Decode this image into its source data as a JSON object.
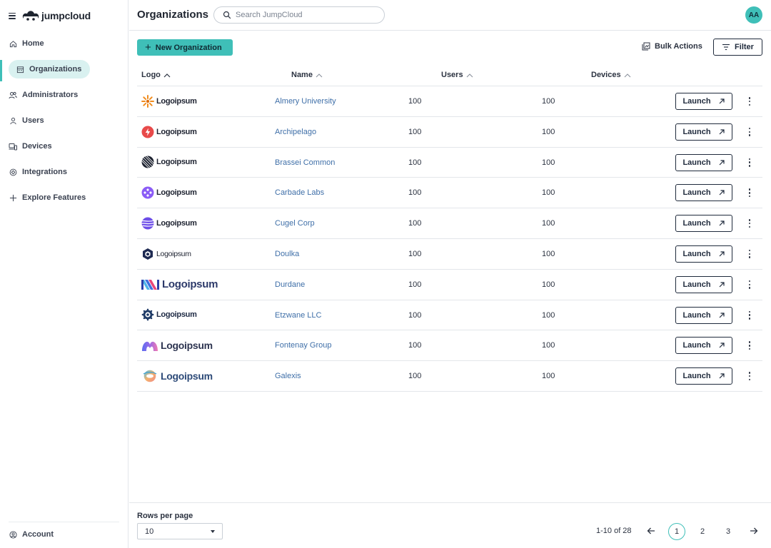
{
  "app": {
    "brand": "jumpcloud",
    "user_initials": "AA",
    "accent": "#3fbfb8",
    "link_color": "#3f6fa8"
  },
  "header": {
    "title": "Organizations",
    "search_placeholder": "Search JumpCloud"
  },
  "sidebar": {
    "items": [
      {
        "label": "Home",
        "icon": "home-icon"
      },
      {
        "label": "Organizations",
        "icon": "building-icon",
        "active": true
      },
      {
        "label": "Administrators",
        "icon": "admins-icon"
      },
      {
        "label": "Users",
        "icon": "user-icon"
      },
      {
        "label": "Devices",
        "icon": "devices-icon"
      },
      {
        "label": "Integrations",
        "icon": "integrations-icon"
      },
      {
        "label": "Explore Features",
        "icon": "plus-icon"
      }
    ],
    "account_label": "Account"
  },
  "toolbar": {
    "new_label": "New Organization",
    "bulk_label": "Bulk Actions",
    "filter_label": "Filter"
  },
  "table": {
    "columns": [
      "Logo",
      "Name",
      "Users",
      "Devices"
    ],
    "launch_label": "Launch",
    "rows": [
      {
        "logo_text": "Logoipsum",
        "logo_style": "sunburst",
        "name": "Almery University",
        "users": "100",
        "devices": "100"
      },
      {
        "logo_text": "Logoipsum",
        "logo_style": "bolt-red",
        "name": "Archipelago",
        "users": "100",
        "devices": "100"
      },
      {
        "logo_text": "Logoipsum",
        "logo_style": "striped-circle",
        "name": "Brassei Common",
        "users": "100",
        "devices": "100"
      },
      {
        "logo_text": "Logoipsum",
        "logo_style": "purple-clover",
        "name": "Carbade Labs",
        "users": "100",
        "devices": "100"
      },
      {
        "logo_text": "Logoipsum",
        "logo_style": "purple-waves",
        "name": "Cugel Corp",
        "users": "100",
        "devices": "100"
      },
      {
        "logo_text": "Logoipsum",
        "logo_style": "navy-hexagon",
        "name": "Doulka",
        "users": "100",
        "devices": "100"
      },
      {
        "logo_text": "Logoipsum",
        "logo_style": "stripes-large",
        "name": "Durdane",
        "users": "100",
        "devices": "100"
      },
      {
        "logo_text": "Logoipsum",
        "logo_style": "gear-navy",
        "name": "Etzwane LLC",
        "users": "100",
        "devices": "100"
      },
      {
        "logo_text": "Logoipsum",
        "logo_style": "arch-gradient",
        "name": "Fontenay Group",
        "users": "100",
        "devices": "100"
      },
      {
        "logo_text": "Logoipsum",
        "logo_style": "ring-gradient",
        "name": "Galexis",
        "users": "100",
        "devices": "100"
      }
    ]
  },
  "pagination": {
    "rows_per_page_label": "Rows per page",
    "rows_per_page_value": "10",
    "range": "1-10 of 28",
    "pages": [
      "1",
      "2",
      "3"
    ],
    "current_page": "1"
  }
}
